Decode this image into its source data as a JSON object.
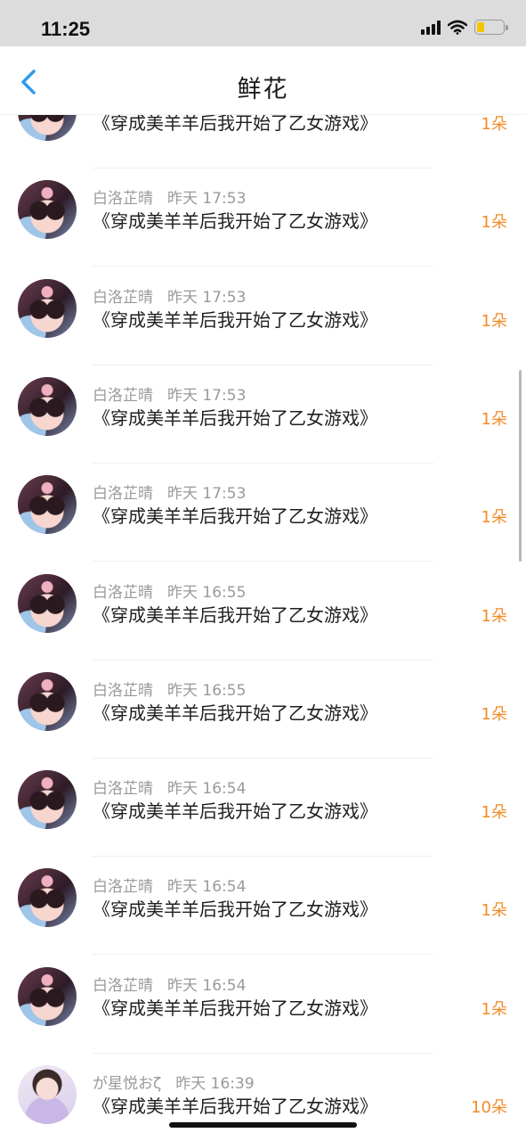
{
  "status_bar": {
    "time": "11:25",
    "battery_level": 0.3
  },
  "header": {
    "title": "鲜花",
    "back_icon": "chevron-left-icon"
  },
  "items": [
    {
      "name": "",
      "time": "",
      "book": "《穿成美羊羊后我开始了乙女游戏》",
      "count": "1朵",
      "avatar": "avatar-a"
    },
    {
      "name": "白洛芷晴",
      "time": "昨天 17:53",
      "book": "《穿成美羊羊后我开始了乙女游戏》",
      "count": "1朵",
      "avatar": "avatar-a"
    },
    {
      "name": "白洛芷晴",
      "time": "昨天 17:53",
      "book": "《穿成美羊羊后我开始了乙女游戏》",
      "count": "1朵",
      "avatar": "avatar-a"
    },
    {
      "name": "白洛芷晴",
      "time": "昨天 17:53",
      "book": "《穿成美羊羊后我开始了乙女游戏》",
      "count": "1朵",
      "avatar": "avatar-a"
    },
    {
      "name": "白洛芷晴",
      "time": "昨天 17:53",
      "book": "《穿成美羊羊后我开始了乙女游戏》",
      "count": "1朵",
      "avatar": "avatar-a"
    },
    {
      "name": "白洛芷晴",
      "time": "昨天 16:55",
      "book": "《穿成美羊羊后我开始了乙女游戏》",
      "count": "1朵",
      "avatar": "avatar-a"
    },
    {
      "name": "白洛芷晴",
      "time": "昨天 16:55",
      "book": "《穿成美羊羊后我开始了乙女游戏》",
      "count": "1朵",
      "avatar": "avatar-a"
    },
    {
      "name": "白洛芷晴",
      "time": "昨天 16:54",
      "book": "《穿成美羊羊后我开始了乙女游戏》",
      "count": "1朵",
      "avatar": "avatar-a"
    },
    {
      "name": "白洛芷晴",
      "time": "昨天 16:54",
      "book": "《穿成美羊羊后我开始了乙女游戏》",
      "count": "1朵",
      "avatar": "avatar-a"
    },
    {
      "name": "白洛芷晴",
      "time": "昨天 16:54",
      "book": "《穿成美羊羊后我开始了乙女游戏》",
      "count": "1朵",
      "avatar": "avatar-a"
    },
    {
      "name": "が星悦おζ",
      "time": "昨天 16:39",
      "book": "《穿成美羊羊后我开始了乙女游戏》",
      "count": "10朵",
      "avatar": "avatar-b"
    }
  ],
  "colors": {
    "count": "#f28c28",
    "meta": "#9a9a9a",
    "back": "#2f9bea"
  }
}
